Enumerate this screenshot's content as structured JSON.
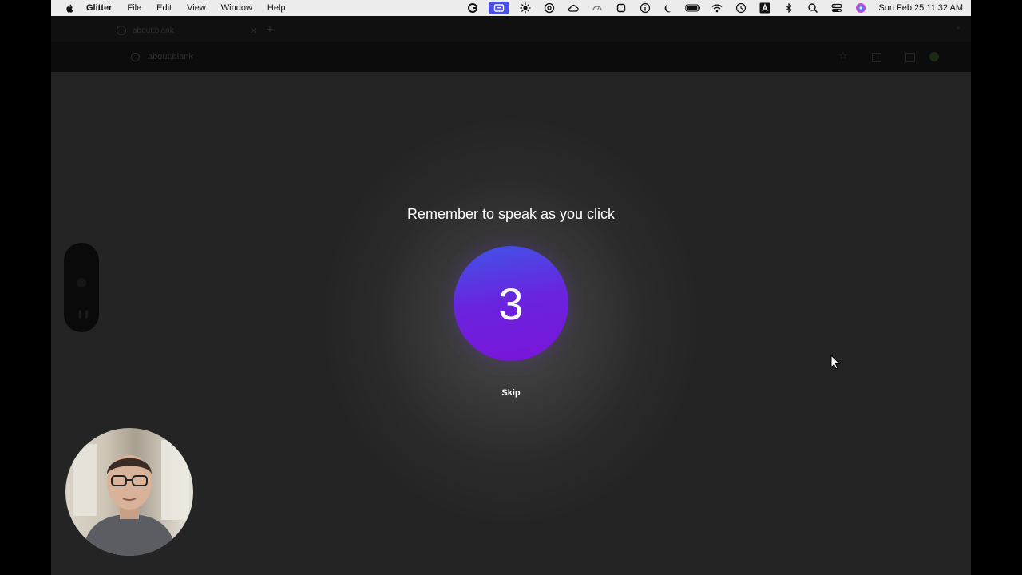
{
  "menubar": {
    "app_name": "Glitter",
    "menus": [
      "File",
      "Edit",
      "View",
      "Window",
      "Help"
    ],
    "status_icons": [
      "g-icon",
      "screen-record-icon",
      "sun-icon",
      "at-icon",
      "cloud-icon",
      "gauge-icon",
      "square-icon",
      "info-icon",
      "moon-icon",
      "battery-icon",
      "wifi-icon",
      "clock-icon",
      "a-icon",
      "bluetooth-icon",
      "search-icon",
      "control-center-icon",
      "siri-icon"
    ],
    "clock": "Sun Feb 25  11:32 AM"
  },
  "browser": {
    "tab_title": "about:blank",
    "address": "about:blank"
  },
  "overlay": {
    "prompt": "Remember to speak as you click",
    "countdown": "3",
    "skip_label": "Skip"
  },
  "colors": {
    "accent_start": "#3f55e8",
    "accent_end": "#7a14d8",
    "menubar_active": "#4b4fe6"
  }
}
